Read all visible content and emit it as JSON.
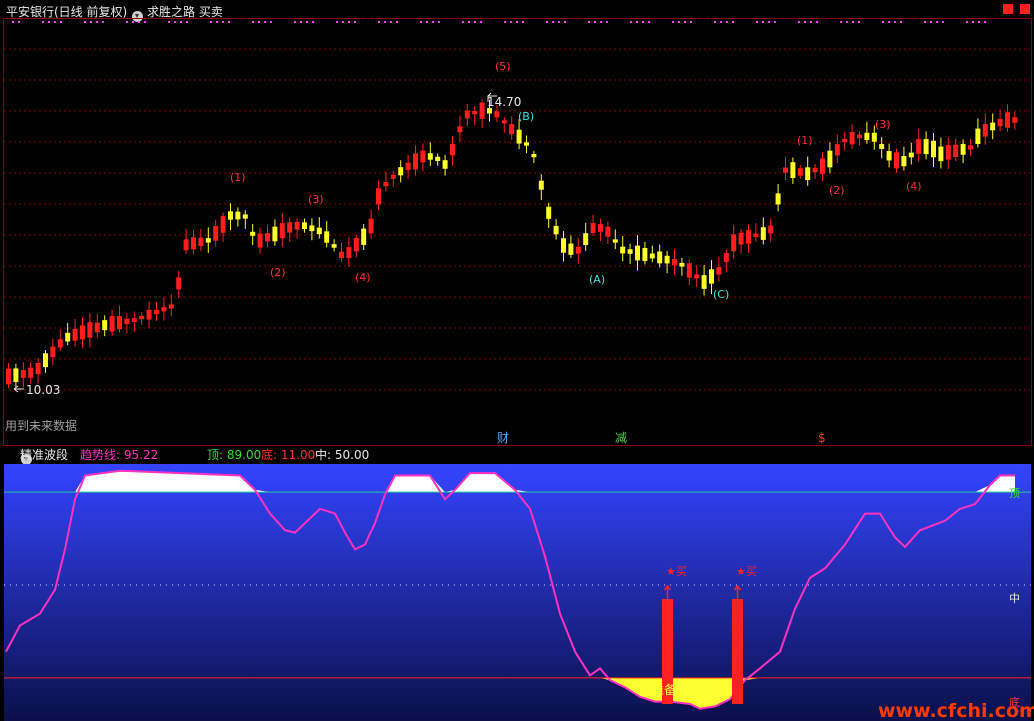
{
  "colors": {
    "up": "#ff1e1e",
    "down": "#ffff2a",
    "wave_red": "#ff3333",
    "wave_cyan": "#44e0e0",
    "trend_line": "#ff30c0",
    "top_line": "#22c8a0",
    "panel_top": "#3444ff",
    "panel_bottom": "#0a104a",
    "grid": "#8a0000"
  },
  "header": {
    "title": "平安银行(日线 前复权)",
    "formula": "求胜之路 买卖"
  },
  "price_panel": {
    "high_label": "14.70",
    "low_label": "10.03",
    "future_warning": "用到未来数据",
    "waves": [
      {
        "label": "(5)",
        "color": "wave_red"
      },
      {
        "label": "(B)",
        "color": "wave_cyan"
      },
      {
        "label": "(1)",
        "color": "wave_red"
      },
      {
        "label": "(2)",
        "color": "wave_red"
      },
      {
        "label": "(3)",
        "color": "wave_red"
      },
      {
        "label": "(4)",
        "color": "wave_red"
      },
      {
        "label": "(A)",
        "color": "wave_cyan"
      },
      {
        "label": "(C)",
        "color": "wave_cyan"
      },
      {
        "label": "(1)",
        "color": "wave_red"
      },
      {
        "label": "(2)",
        "color": "wave_red"
      },
      {
        "label": "(3)",
        "color": "wave_red"
      },
      {
        "label": "(4)",
        "color": "wave_red"
      }
    ],
    "markers": [
      {
        "label": "财",
        "color": "#4aa8ff"
      },
      {
        "label": "减",
        "color": "#40d040"
      },
      {
        "label": "$",
        "color": "#ff3030"
      }
    ]
  },
  "indicator": {
    "name": "精准波段",
    "trend_label": "趋势线: 95.22",
    "top_label": "顶: 89.00",
    "bottom_label": "底: 11.00",
    "mid_label": "中: 50.00",
    "top_value": 89,
    "bottom_value": 11,
    "mid_value": 50,
    "axis_top": "顶",
    "axis_mid": "中",
    "axis_bottom": "底",
    "buy_signals": [
      "买",
      "买"
    ],
    "ready_text": "准备买入"
  },
  "chart_data": {
    "type": "candlestick",
    "symbol": "平安银行",
    "period": "日线 前复权",
    "labeled_high": 14.7,
    "labeled_low": 10.03,
    "indicator_trend_last": 95.22,
    "indicator_levels": {
      "top": 89.0,
      "bottom": 11.0,
      "mid": 50.0
    }
  },
  "watermark": "www.cfchi.com"
}
